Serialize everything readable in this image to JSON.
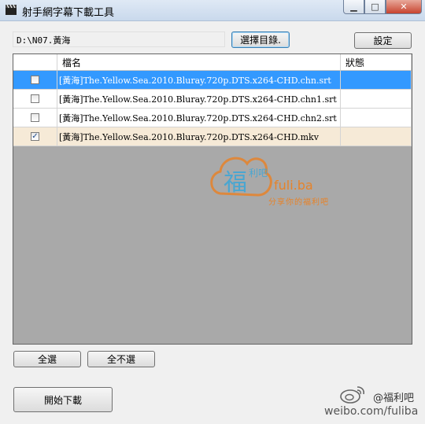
{
  "window": {
    "title": "射手網字幕下載工具",
    "minimize_glyph": "▁",
    "maximize_glyph": "□",
    "close_glyph": "✕"
  },
  "toolbar": {
    "path_value": "D:\\N07.黃海",
    "choose_dir_label": "選擇目錄.",
    "settings_label": "設定"
  },
  "grid": {
    "columns": [
      "",
      "檔名",
      "狀態"
    ],
    "rows": [
      {
        "checked": false,
        "check_glyph": "",
        "filename": "[黃海]The.Yellow.Sea.2010.Bluray.720p.DTS.x264-CHD.chn.srt",
        "status": "",
        "selected": true
      },
      {
        "checked": false,
        "check_glyph": "",
        "filename": "[黃海]The.Yellow.Sea.2010.Bluray.720p.DTS.x264-CHD.chn1.srt",
        "status": "",
        "selected": false
      },
      {
        "checked": false,
        "check_glyph": "",
        "filename": "[黃海]The.Yellow.Sea.2010.Bluray.720p.DTS.x264-CHD.chn2.srt",
        "status": "",
        "selected": false
      },
      {
        "checked": true,
        "check_glyph": "✓",
        "filename": "[黃海]The.Yellow.Sea.2010.Bluray.720p.DTS.x264-CHD.mkv",
        "status": "",
        "selected": false
      }
    ]
  },
  "buttons": {
    "select_all": "全選",
    "select_none": "全不選",
    "start_download": "開始下載"
  },
  "watermark": {
    "site": "fuli.ba",
    "tagline": "分享你的福利吧",
    "logo_text_main": "福",
    "logo_text_side": "利吧"
  },
  "weibo": {
    "handle": "@福利吧",
    "url": "weibo.com/fuliba"
  },
  "colors": {
    "selection": "#3399ff",
    "checked_row": "#f6ead7",
    "grid_background": "#a9a9a9",
    "watermark": "#e6832a"
  }
}
